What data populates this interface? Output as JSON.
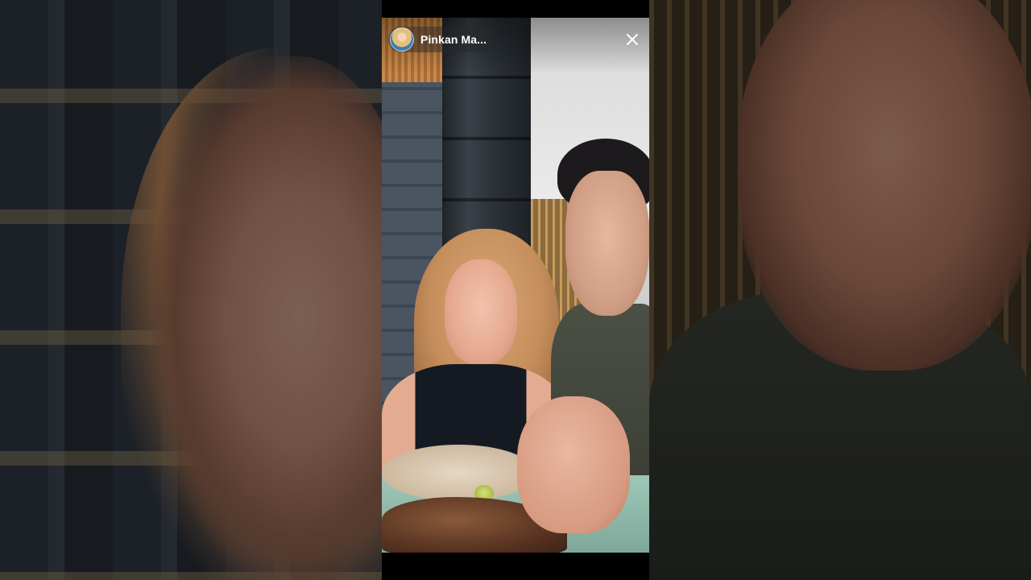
{
  "story": {
    "username": "Pinkan Ma...",
    "avatar_icon": "profile-avatar",
    "close_icon": "close-icon"
  },
  "colors": {
    "overlay_text": "#ffffff",
    "chip_background": "#282828"
  }
}
